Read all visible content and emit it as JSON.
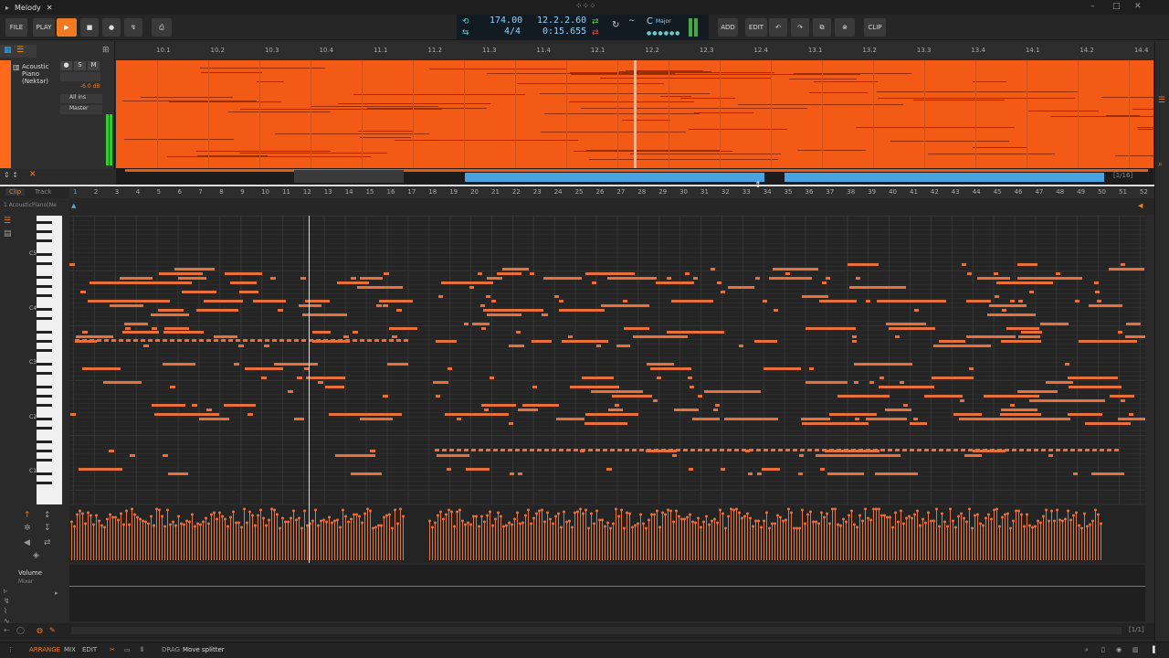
{
  "window": {
    "title": "Melody",
    "close_glyph": "✕"
  },
  "toolbar": {
    "file": "FILE",
    "play_label": "PLAY",
    "add": "ADD",
    "edit": "EDIT",
    "clip": "CLIP"
  },
  "transport": {
    "tempo": "174.00",
    "time_sig": "4/4",
    "position": "12.2.2.60",
    "time": "0:15.655",
    "key_root": "C",
    "key_scale": "Major"
  },
  "track": {
    "name_line1": "Acoustic",
    "name_line2": "Piano",
    "name_line3": "(Nektar)",
    "solo": "S",
    "mute": "M",
    "volume": "-6.0 dB",
    "input": "All ins",
    "output": "Master"
  },
  "arranger_ruler": [
    "10.1",
    "10.2",
    "10.3",
    "10.4",
    "11.1",
    "11.2",
    "11.3",
    "11.4",
    "12.1",
    "12.2",
    "12.3",
    "12.4",
    "13.1",
    "13.2",
    "13.3",
    "13.4",
    "14.1",
    "14.2",
    "14.4"
  ],
  "overview": {
    "page": "[1/16]"
  },
  "editor": {
    "tab_clip": "Clip",
    "tab_track": "Track",
    "clip_name": "1  AcousticPiano(Ne",
    "bar_numbers": [
      "1",
      "2",
      "3",
      "4",
      "5",
      "6",
      "7",
      "8",
      "9",
      "10",
      "11",
      "12",
      "13",
      "14",
      "15",
      "16",
      "17",
      "18",
      "19",
      "20",
      "21",
      "22",
      "23",
      "24",
      "25",
      "26",
      "27",
      "28",
      "29",
      "30",
      "31",
      "32",
      "33",
      "34",
      "35",
      "36",
      "37",
      "38",
      "39",
      "40",
      "41",
      "42",
      "43",
      "44",
      "45",
      "46",
      "47",
      "48",
      "49",
      "50",
      "51",
      "52"
    ],
    "octave_labels": [
      "C5",
      "C4",
      "C3",
      "C2",
      "C1"
    ],
    "volume_lane_title": "Volume",
    "volume_lane_sub": "Mixer",
    "lane_page": "[1/1]"
  },
  "statusbar": {
    "arrange": "ARRANGE",
    "mix": "MIX",
    "edit": "EDIT",
    "hint_key": "DRAG",
    "hint_text": "Move splitter"
  },
  "colors": {
    "accent": "#f07a22",
    "clip": "#f25a16",
    "note": "#e8703a",
    "transport_text": "#8fd3ff"
  }
}
